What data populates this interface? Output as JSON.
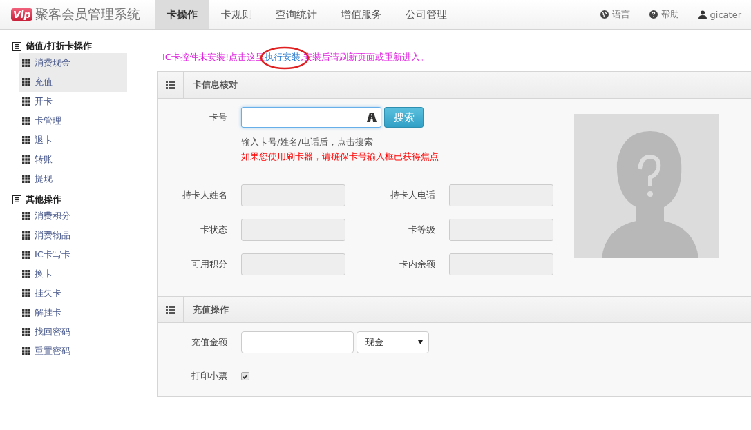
{
  "app": {
    "logo_badge": "Vip",
    "title": "聚客会员管理系统"
  },
  "nav_tabs": [
    {
      "label": "卡操作",
      "selected": true
    },
    {
      "label": "卡规则",
      "selected": false
    },
    {
      "label": "查询统计",
      "selected": false
    },
    {
      "label": "增值服务",
      "selected": false
    },
    {
      "label": "公司管理",
      "selected": false
    }
  ],
  "user_menu": [
    {
      "kind": "language",
      "label": "语言"
    },
    {
      "kind": "help",
      "label": "帮助"
    },
    {
      "kind": "user",
      "label": "gicater"
    }
  ],
  "sidebar": {
    "sections": [
      {
        "title": "储值/打折卡操作",
        "items": [
          {
            "label": "消费现金",
            "selected": true
          },
          {
            "label": "充值",
            "selected": true
          },
          {
            "label": "开卡",
            "selected": false
          },
          {
            "label": "卡管理",
            "selected": false
          },
          {
            "label": "退卡",
            "selected": false
          },
          {
            "label": "转账",
            "selected": false
          },
          {
            "label": "提现",
            "selected": false
          }
        ]
      },
      {
        "title": "其他操作",
        "items": [
          {
            "label": "消费积分",
            "selected": false
          },
          {
            "label": "消费物品",
            "selected": false
          },
          {
            "label": "IC卡写卡",
            "selected": false
          },
          {
            "label": "换卡",
            "selected": false
          },
          {
            "label": "挂失卡",
            "selected": false
          },
          {
            "label": "解挂卡",
            "selected": false
          },
          {
            "label": "找回密码",
            "selected": false
          },
          {
            "label": "重置密码",
            "selected": false
          }
        ]
      }
    ]
  },
  "notice": {
    "text": "IC卡控件未安装!点击这里",
    "link": "执行安装",
    "after": ",安装后请刷新页面或重新进入。"
  },
  "card_panel": {
    "title": "卡信息核对",
    "card_number_label": "卡号",
    "search_button": "搜索",
    "hint": "输入卡号/姓名/电话后，点击搜索",
    "warning": "如果您使用刷卡器，请确保卡号输入框已获得焦点",
    "fields": [
      {
        "label": "持卡人姓名"
      },
      {
        "label": "持卡人电话"
      },
      {
        "label": "卡状态"
      },
      {
        "label": "卡等级"
      },
      {
        "label": "可用积分"
      },
      {
        "label": "卡内余额"
      }
    ]
  },
  "recharge_panel": {
    "title": "充值操作",
    "amount_label": "充值金额",
    "payment_method": "现金",
    "print_label": "打印小票",
    "print_checked": true
  }
}
